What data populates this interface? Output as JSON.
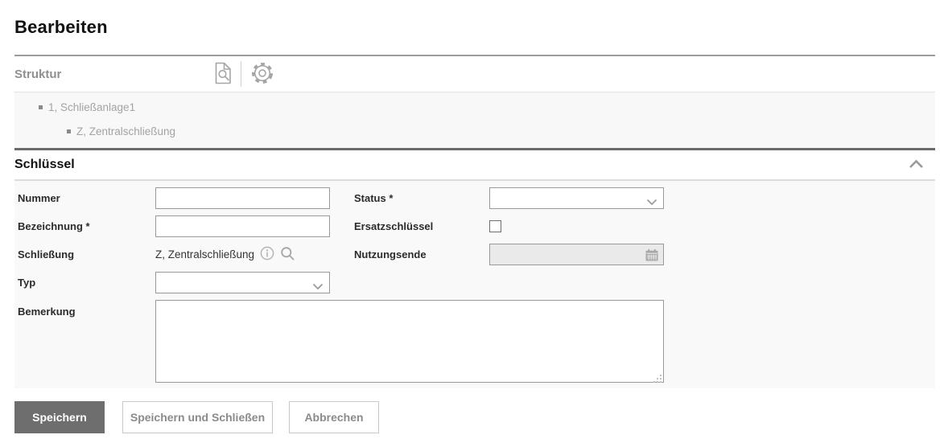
{
  "page_title": "Bearbeiten",
  "struktur_panel": {
    "title": "Struktur",
    "toolbar": {
      "preview_icon": "document-search-icon",
      "settings_icon": "gear-icon"
    },
    "tree": [
      {
        "label": "1, Schließanlage1",
        "level": 1
      },
      {
        "label": "Z, Zentralschließung",
        "level": 2
      }
    ]
  },
  "schluessel_section": {
    "title": "Schlüssel",
    "collapse_icon": "chevron-up-icon",
    "fields": {
      "nummer": {
        "label": "Nummer",
        "value": ""
      },
      "status": {
        "label": "Status *",
        "value": "",
        "type": "dropdown"
      },
      "bezeichnung": {
        "label": "Bezeichnung *",
        "value": ""
      },
      "ersatzschluessel": {
        "label": "Ersatzschlüssel",
        "checked": false
      },
      "schliessung": {
        "label": "Schließung",
        "value": "Z, Zentralschließung",
        "icons": [
          "info-icon",
          "search-icon"
        ]
      },
      "nutzungsende": {
        "label": "Nutzungsende",
        "value": "",
        "disabled": true,
        "icon": "calendar-icon"
      },
      "typ": {
        "label": "Typ",
        "value": "",
        "type": "dropdown"
      },
      "bemerkung": {
        "label": "Bemerkung",
        "value": ""
      }
    }
  },
  "actions": {
    "save": "Speichern",
    "save_and_close": "Speichern und Schließen",
    "cancel": "Abbrechen"
  },
  "colors": {
    "primary_button_bg": "#6e6e6e",
    "primary_button_text": "#ffffff",
    "secondary_button_text": "#8b8b8b",
    "dark_section_divider": "#6b6b6b",
    "title_divider": "#9b9b9b",
    "panel_bg": "#f8f8f8",
    "form_bg": "#f9f9f9",
    "muted_text": "#a3a3a3",
    "label_text": "#2b2b2b",
    "input_border": "#999999",
    "icon_gray": "#a5a5a5"
  }
}
